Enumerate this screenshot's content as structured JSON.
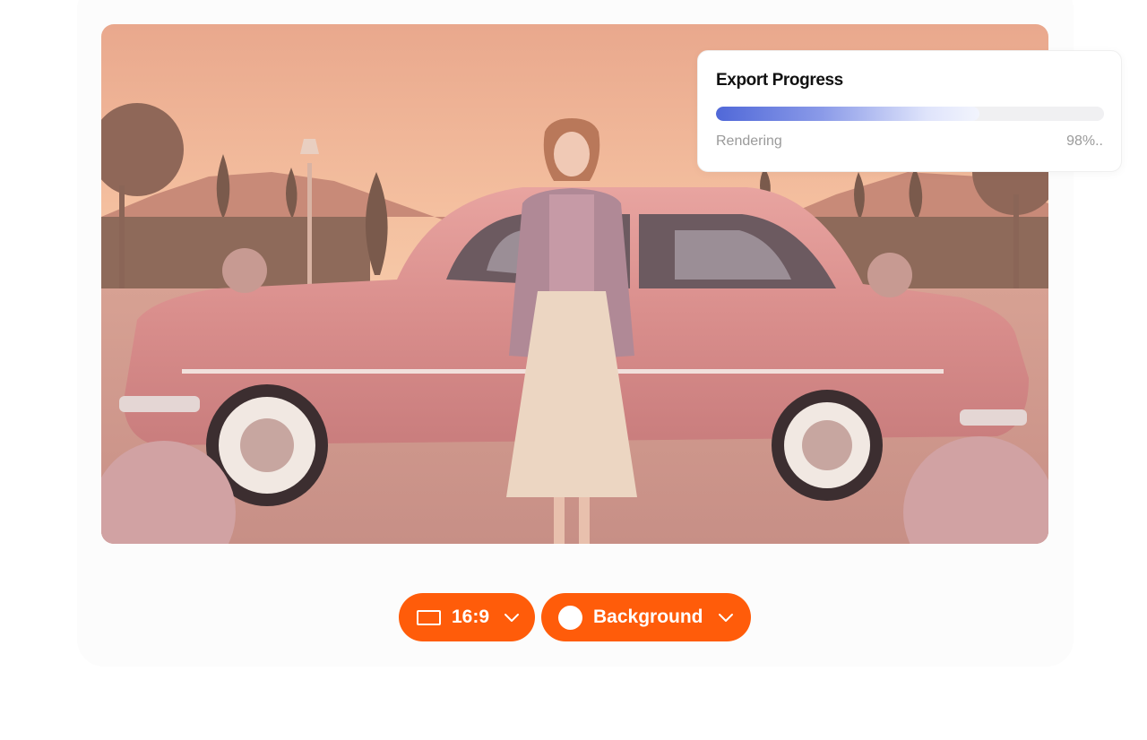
{
  "export": {
    "title": "Export Progress",
    "status": "Rendering",
    "percent_label": "98%..",
    "progress_fraction": 0.68
  },
  "controls": {
    "aspect_ratio": {
      "label": "16:9",
      "icon": "aspect-ratio-icon"
    },
    "background": {
      "label": "Background",
      "icon": "circle-icon"
    }
  },
  "preview": {
    "subject": "woman-standing-in-front-of-vintage-pink-car"
  },
  "colors": {
    "accent": "#ff5c0a",
    "progress_start": "#5068d8",
    "scene_tint": "#e8a58c"
  }
}
